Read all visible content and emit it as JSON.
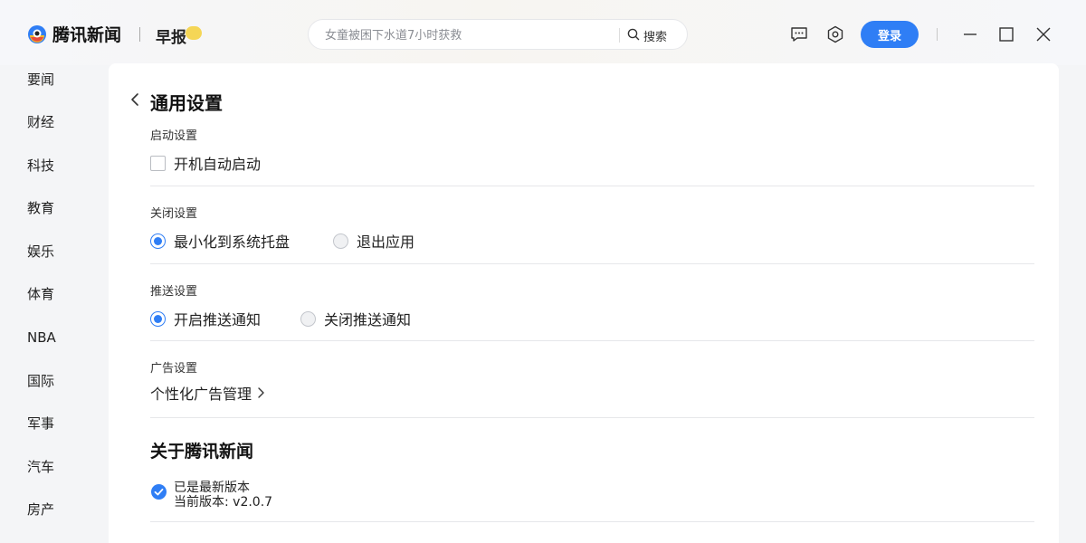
{
  "app": {
    "brand": "腾讯新闻",
    "zaobao": "早报"
  },
  "search": {
    "placeholder": "女童被困下水道7小时获救",
    "button_label": "搜索"
  },
  "toolbar": {
    "login_label": "登录",
    "icons": [
      "message-icon",
      "settings-icon",
      "minimize-icon",
      "maximize-icon",
      "close-icon"
    ]
  },
  "sidebar": {
    "items": [
      {
        "label": "要闻"
      },
      {
        "label": "财经"
      },
      {
        "label": "科技"
      },
      {
        "label": "教育"
      },
      {
        "label": "娱乐"
      },
      {
        "label": "体育"
      },
      {
        "label": "NBA"
      },
      {
        "label": "国际"
      },
      {
        "label": "军事"
      },
      {
        "label": "汽车"
      },
      {
        "label": "房产"
      }
    ]
  },
  "settings": {
    "title": "通用设置",
    "startup": {
      "label": "启动设置",
      "auto_start": {
        "label": "开机自动启动",
        "checked": false
      }
    },
    "close": {
      "label": "关闭设置",
      "options": [
        {
          "label": "最小化到系统托盘",
          "selected": true
        },
        {
          "label": "退出应用",
          "selected": false
        }
      ]
    },
    "push": {
      "label": "推送设置",
      "options": [
        {
          "label": "开启推送通知",
          "selected": true
        },
        {
          "label": "关闭推送通知",
          "selected": false
        }
      ]
    },
    "ads": {
      "label": "广告设置",
      "link_label": "个性化广告管理"
    },
    "about": {
      "title": "关于腾讯新闻",
      "status": "已是最新版本",
      "version": "当前版本: v2.0.7"
    }
  },
  "colors": {
    "accent": "#2f7ef5",
    "background": "#f4f5f7",
    "panel": "#ffffff"
  }
}
